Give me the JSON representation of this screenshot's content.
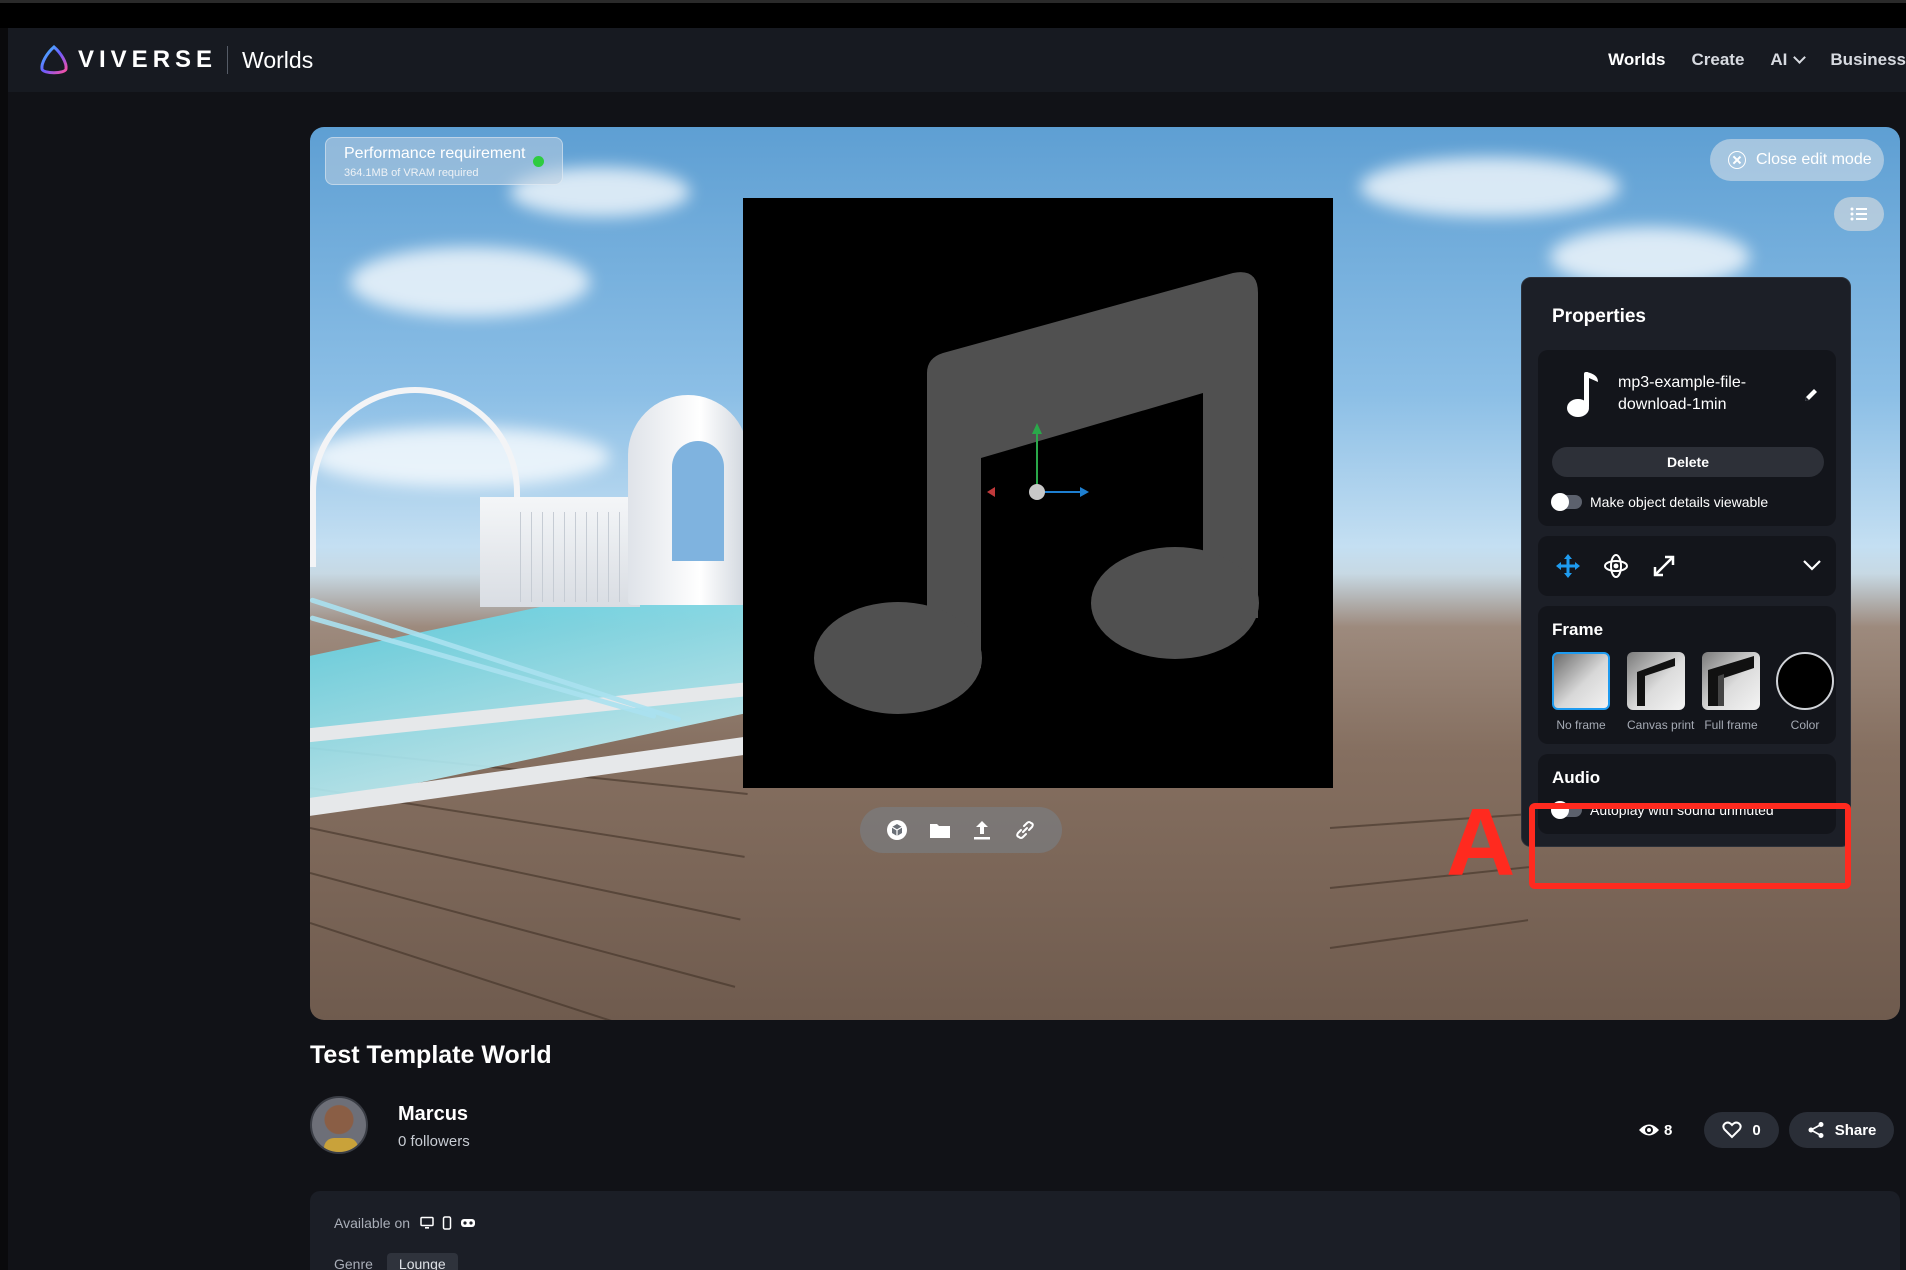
{
  "brand": {
    "logo_text": "VIVERSE",
    "section": "Worlds"
  },
  "nav": {
    "items": [
      {
        "label": "Worlds",
        "active": true
      },
      {
        "label": "Create",
        "active": false
      },
      {
        "label": "AI",
        "active": false,
        "has_dropdown": true
      },
      {
        "label": "Business",
        "active": false
      }
    ]
  },
  "viewport": {
    "performance": {
      "title": "Performance requirement",
      "subtitle": "364.1MB of VRAM required",
      "status_color": "#2ecc40"
    },
    "close_edit_label": "Close edit mode",
    "list_icon": "list-icon",
    "toolbar_icons": [
      "cube-icon",
      "folder-icon",
      "upload-icon",
      "link-icon"
    ]
  },
  "properties": {
    "title": "Properties",
    "file": {
      "name": "mp3-example-file-download-1min",
      "icon": "music-note-icon",
      "edit_icon": "pencil-icon"
    },
    "delete_label": "Delete",
    "details_toggle": {
      "label": "Make object details viewable",
      "on": false
    },
    "transform_icons": [
      "move-icon",
      "rotate-icon",
      "scale-icon",
      "chevron-down-icon"
    ],
    "frame": {
      "title": "Frame",
      "options": [
        {
          "label": "No frame",
          "selected": true
        },
        {
          "label": "Canvas print",
          "selected": false
        },
        {
          "label": "Full frame",
          "selected": false
        },
        {
          "label": "Color",
          "selected": false
        }
      ]
    },
    "audio": {
      "title": "Audio",
      "autoplay_toggle": {
        "label": "Autoplay with sound unmuted",
        "on": false
      }
    }
  },
  "annotation": {
    "marker": "A",
    "color": "#ff2a1f"
  },
  "world": {
    "title": "Test Template World",
    "author": "Marcus",
    "followers": "0 followers",
    "views": "8",
    "likes": "0",
    "share_label": "Share",
    "available_on_label": "Available on",
    "platform_icons": [
      "desktop-icon",
      "mobile-icon",
      "vr-headset-icon"
    ],
    "genre_label": "Genre",
    "genre_value": "Lounge"
  },
  "colors": {
    "accent_blue": "#1e9bf0",
    "panel_bg": "#1c1f27",
    "header_bg": "#171a21",
    "highlight_red": "#ff2a1f"
  }
}
